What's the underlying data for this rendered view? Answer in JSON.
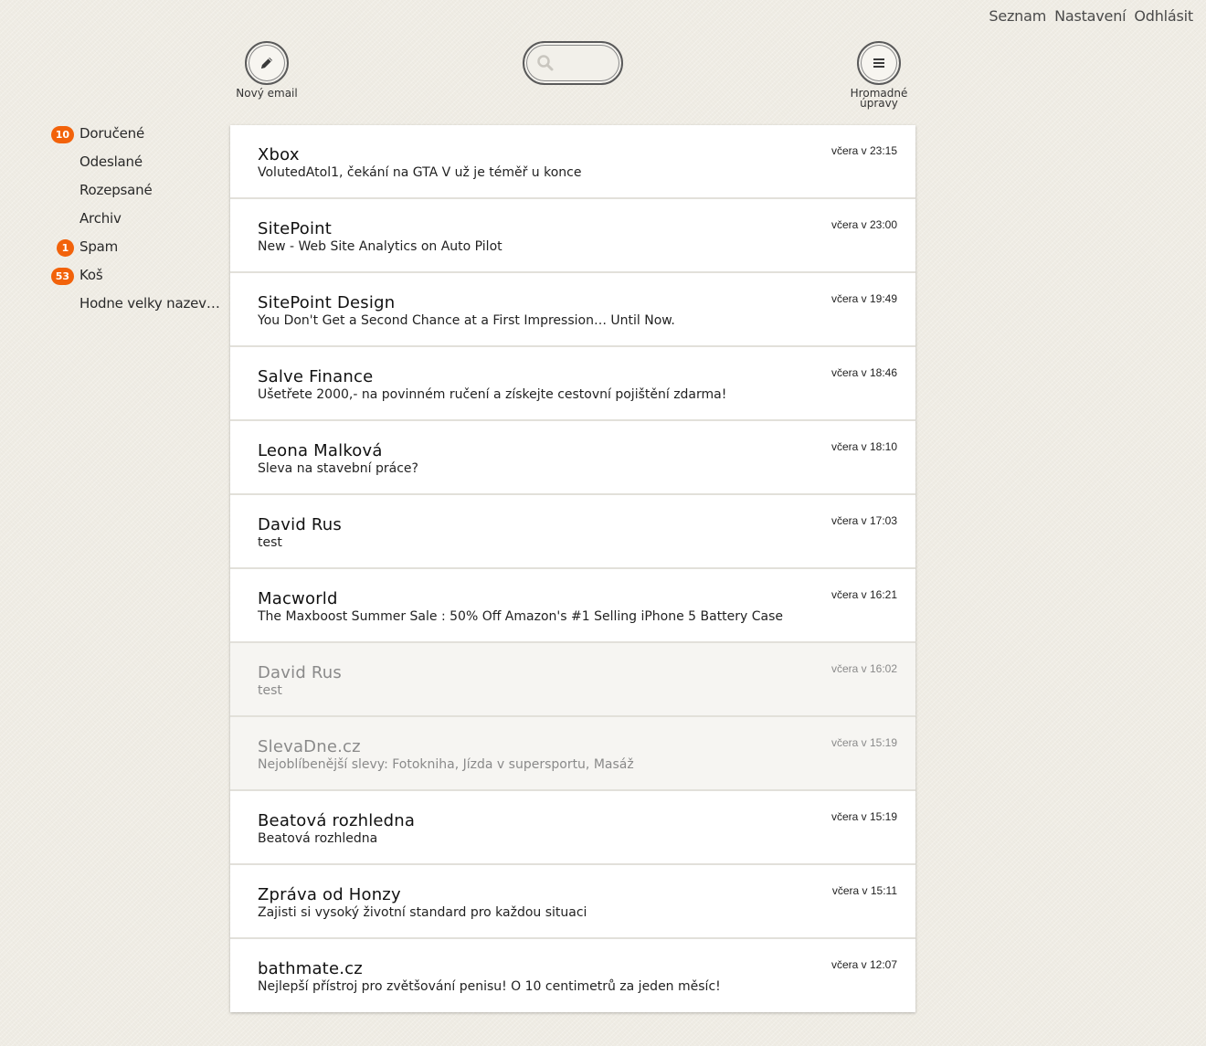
{
  "topnav": {
    "links": [
      "Seznam",
      "Nastavení",
      "Odhlásit"
    ]
  },
  "toolbar": {
    "new_email_label": "Nový email",
    "bulk_edit_label": "Hromadné úpravy",
    "search_placeholder": ""
  },
  "sidebar": {
    "folders": [
      {
        "name": "Doručené",
        "badge": "10"
      },
      {
        "name": "Odeslané",
        "badge": null
      },
      {
        "name": "Rozepsané",
        "badge": null
      },
      {
        "name": "Archiv",
        "badge": null
      },
      {
        "name": "Spam",
        "badge": "1"
      },
      {
        "name": "Koš",
        "badge": "53"
      },
      {
        "name": "Hodne velky nazev…",
        "badge": null
      }
    ]
  },
  "mails": [
    {
      "sender": "Xbox",
      "subject": "VolutedAtol1, čekání na GTA V už je téměř u konce",
      "time": "včera v 23:15",
      "read": false
    },
    {
      "sender": "SitePoint",
      "subject": "New - Web Site Analytics on Auto Pilot",
      "time": "včera v 23:00",
      "read": false
    },
    {
      "sender": "SitePoint Design",
      "subject": "You Don't Get a Second Chance at a First Impression… Until Now.",
      "time": "včera v 19:49",
      "read": false
    },
    {
      "sender": "Salve Finance",
      "subject": "Ušetřete 2000,- na povinném ručení a získejte cestovní pojištění zdarma!",
      "time": "včera v 18:46",
      "read": false
    },
    {
      "sender": "Leona Malková",
      "subject": "Sleva na stavební práce?",
      "time": "včera v 18:10",
      "read": false
    },
    {
      "sender": "David Rus",
      "subject": "test",
      "time": "včera v 17:03",
      "read": false
    },
    {
      "sender": "Macworld",
      "subject": "The Maxboost Summer Sale : 50% Off Amazon's #1 Selling iPhone 5 Battery Case",
      "time": "včera v 16:21",
      "read": false
    },
    {
      "sender": "David Rus",
      "subject": "test",
      "time": "včera v 16:02",
      "read": true
    },
    {
      "sender": "SlevaDne.cz",
      "subject": "Nejoblíbenější slevy: Fotokniha, Jízda v supersportu, Masáž",
      "time": "včera v 15:19",
      "read": true
    },
    {
      "sender": "Beatová rozhledna",
      "subject": "Beatová rozhledna",
      "time": "včera v 15:19",
      "read": false
    },
    {
      "sender": "Zpráva od Honzy",
      "subject": "Zajisti si vysoký životní standard pro každou situaci",
      "time": "včera v 15:11",
      "read": false
    },
    {
      "sender": "bathmate.cz",
      "subject": "Nejlepší přístroj pro zvětšování penisu! O 10 centimetrů za jeden měsíc!",
      "time": "včera v 12:07",
      "read": false
    }
  ]
}
